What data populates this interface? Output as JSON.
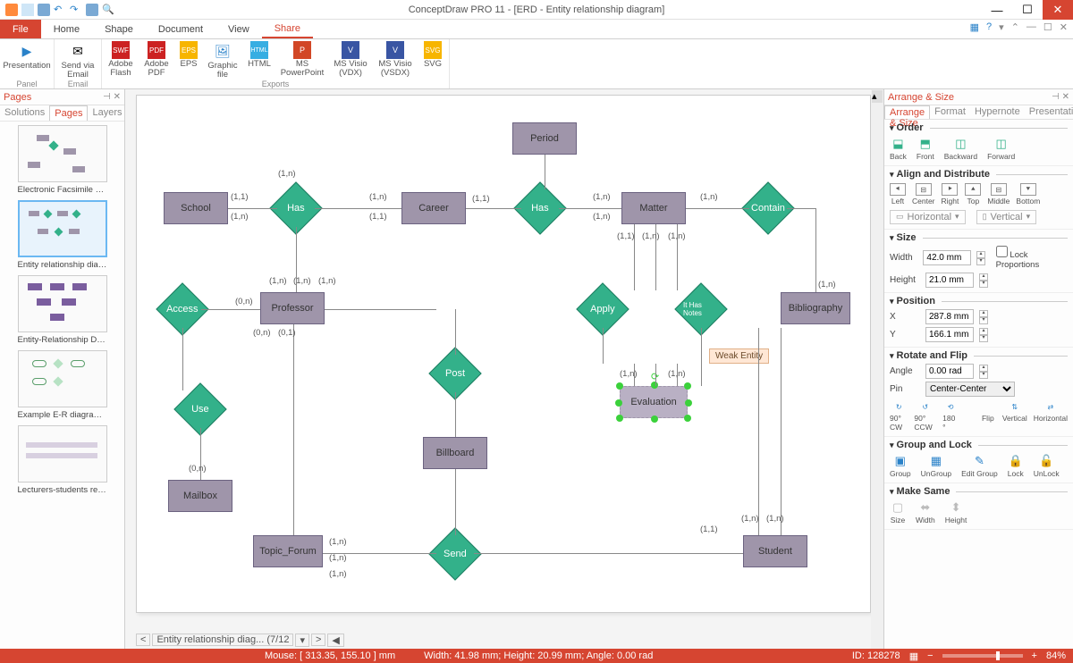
{
  "app": {
    "title": "ConceptDraw PRO 11 - [ERD - Entity relationship diagram]"
  },
  "menus": {
    "file": "File",
    "home": "Home",
    "shape": "Shape",
    "document": "Document",
    "view": "View",
    "share": "Share"
  },
  "ribbon": {
    "panel": {
      "presentation": "Presentation",
      "group": "Panel"
    },
    "email": {
      "sendvia": "Send via Email",
      "group": "Email"
    },
    "exports": {
      "flash": "Adobe Flash",
      "pdf": "Adobe PDF",
      "eps": "EPS",
      "graphic": "Graphic file",
      "html": "HTML",
      "ppt": "MS PowerPoint",
      "visio_vdx": "MS Visio (VDX)",
      "visio_vsdx": "MS Visio (VSDX)",
      "svg": "SVG",
      "group": "Exports"
    }
  },
  "pages_panel": {
    "title": "Pages",
    "tabs": {
      "solutions": "Solutions",
      "pages": "Pages",
      "layers": "Layers"
    },
    "thumbs": [
      {
        "label": "Electronic Facsimile Coll..."
      },
      {
        "label": "Entity relationship diagram"
      },
      {
        "label": "Entity-Relationship Diagr..."
      },
      {
        "label": "Example E-R diagram ext..."
      },
      {
        "label": "Lecturers-students relatio..."
      }
    ]
  },
  "canvas": {
    "entities": {
      "period": "Period",
      "school": "School",
      "career": "Career",
      "matter": "Matter",
      "professor": "Professor",
      "bibliography": "Bibliography",
      "billboard": "Billboard",
      "mailbox": "Mailbox",
      "topic_forum": "Topic_Forum",
      "student": "Student",
      "evaluation": "Evaluation"
    },
    "relations": {
      "has1": "Has",
      "has2": "Has",
      "contain": "Contain",
      "access": "Access",
      "apply": "Apply",
      "ithasnotes": "It Has Notes",
      "post": "Post",
      "use": "Use",
      "send": "Send"
    },
    "tooltip": "Weak Entity",
    "tabs": {
      "label": "Entity relationship diag...",
      "counter": "(7/12"
    }
  },
  "right_panel": {
    "title": "Arrange & Size",
    "tabs": {
      "arrange": "Arrange & Size",
      "format": "Format",
      "hypernote": "Hypernote",
      "presentation": "Presentation"
    },
    "order": {
      "title": "Order",
      "back": "Back",
      "front": "Front",
      "backward": "Backward",
      "forward": "Forward"
    },
    "align": {
      "title": "Align and Distribute",
      "left": "Left",
      "center": "Center",
      "right": "Right",
      "top": "Top",
      "middle": "Middle",
      "bottom": "Bottom",
      "horizontal": "Horizontal",
      "vertical": "Vertical"
    },
    "size": {
      "title": "Size",
      "width_label": "Width",
      "width": "42.0 mm",
      "height_label": "Height",
      "height": "21.0 mm",
      "lock": "Lock Proportions"
    },
    "position": {
      "title": "Position",
      "x_label": "X",
      "x": "287.8 mm",
      "y_label": "Y",
      "y": "166.1 mm"
    },
    "rotate": {
      "title": "Rotate and Flip",
      "angle_label": "Angle",
      "angle": "0.00 rad",
      "pin_label": "Pin",
      "pin": "Center-Center",
      "cw90": "90° CW",
      "ccw90": "90° CCW",
      "r180": "180 °",
      "flip": "Flip",
      "vertical": "Vertical",
      "horizontal": "Horizontal"
    },
    "group": {
      "title": "Group and Lock",
      "group": "Group",
      "ungroup": "UnGroup",
      "editgroup": "Edit Group",
      "lock": "Lock",
      "unlock": "UnLock"
    },
    "makesame": {
      "title": "Make Same",
      "size": "Size",
      "width": "Width",
      "height": "Height"
    }
  },
  "status": {
    "mouse": "Mouse: [ 313.35, 155.10 ] mm",
    "dims": "Width: 41.98 mm;  Height: 20.99 mm;  Angle: 0.00 rad",
    "id": "ID: 128278",
    "zoom": "84%"
  },
  "card": {
    "c1n": "(1,n)",
    "c11": "(1,1)",
    "c0n": "(0,n)",
    "c01": "(0,1)"
  }
}
